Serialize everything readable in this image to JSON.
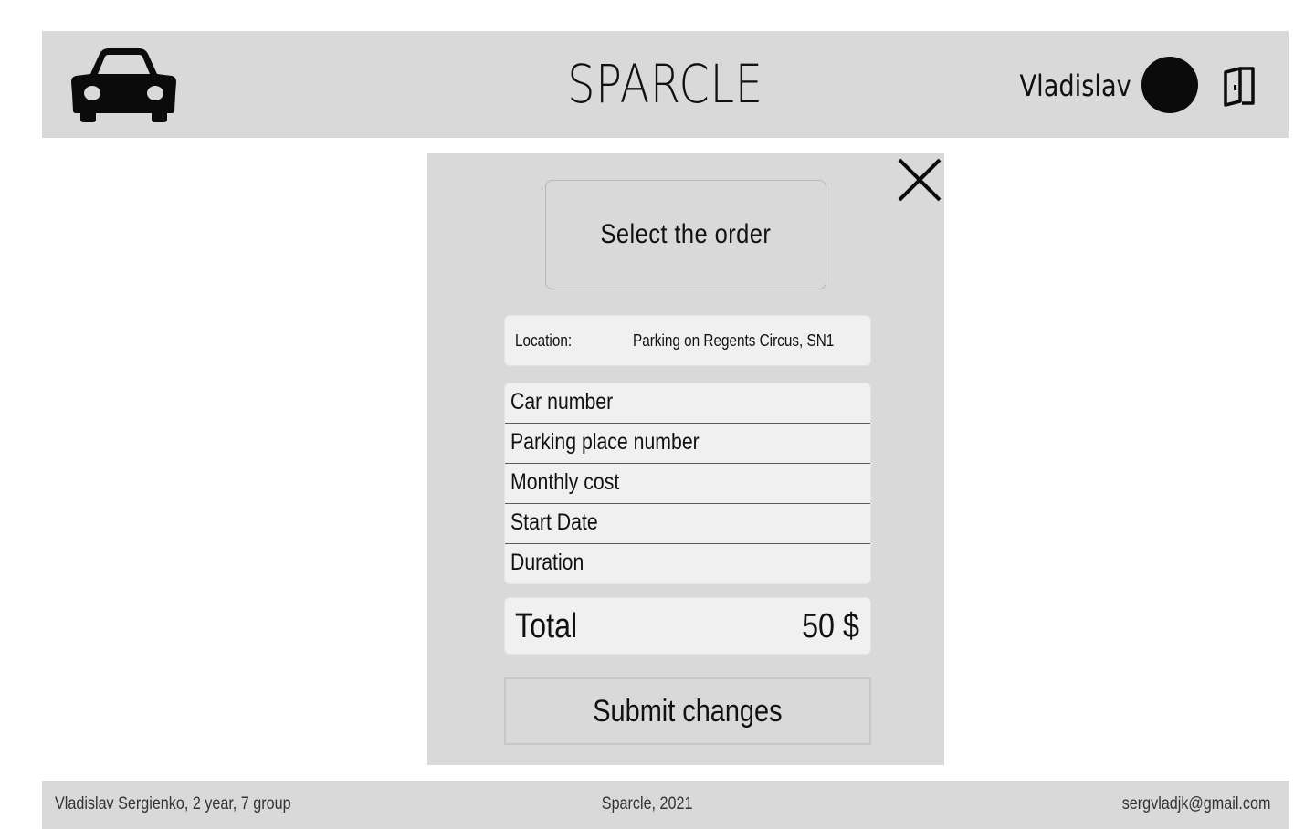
{
  "header": {
    "logo_icon": "car-icon",
    "title": "SPARCLE",
    "user_name": "Vladislav",
    "avatar_color": "#0b0b0b",
    "logout_icon": "door-exit-icon"
  },
  "modal": {
    "close_icon": "close-icon",
    "select_order_label": "Select the order",
    "location": {
      "label": "Location:",
      "value": "Parking on Regents Circus, SN1"
    },
    "fields": [
      {
        "label": "Car number"
      },
      {
        "label": "Parking place number"
      },
      {
        "label": "Monthly cost"
      },
      {
        "label": "Start Date"
      },
      {
        "label": "Duration"
      }
    ],
    "total": {
      "label": "Total",
      "value": "50 $"
    },
    "submit_label": "Submit changes"
  },
  "footer": {
    "left": "Vladislav Sergienko, 2 year, 7 group",
    "center": "Sparcle, 2021",
    "right": "sergvladjk@gmail.com"
  },
  "colors": {
    "panel_bg": "#d9d9d9",
    "field_bg": "#f1f0f1",
    "text": "#111111"
  }
}
